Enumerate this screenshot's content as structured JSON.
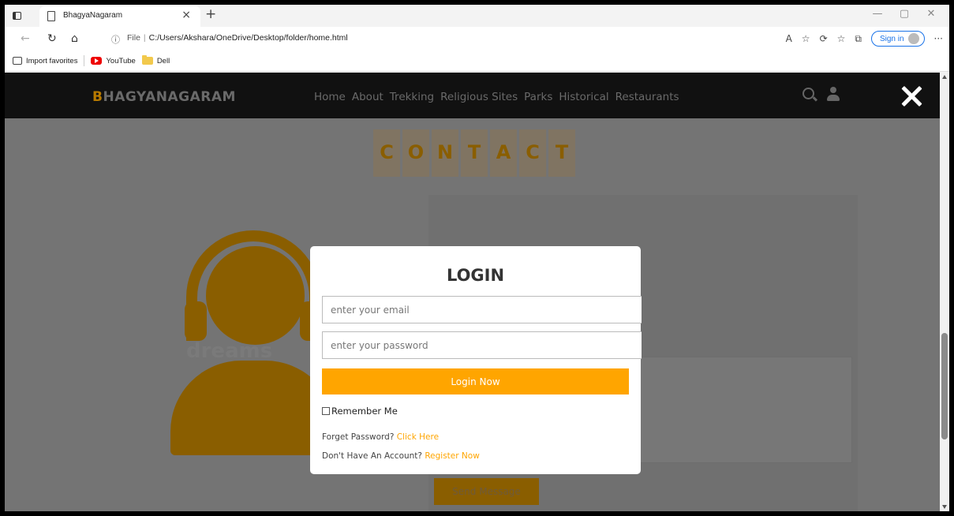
{
  "browser": {
    "tab_title": "BhagyaNagaram",
    "tab_close": "×",
    "new_tab": "+",
    "address": {
      "scheme_label": "File",
      "path": "C:/Users/Akshara/OneDrive/Desktop/folder/home.html"
    },
    "sign_in_label": "Sign in",
    "window_controls": [
      "—",
      "▢",
      "✕"
    ],
    "nav_icons": [
      "back-icon",
      "refresh-icon",
      "home-icon"
    ],
    "toolbar_icons": [
      "read-aloud-icon",
      "favorite-add-icon",
      "extensions-icon",
      "favorites-icon",
      "collections-icon",
      "more-icon"
    ]
  },
  "favorites": [
    {
      "label": "Import favorites",
      "icon": "import-icon"
    },
    {
      "label": "YouTube",
      "icon": "youtube-icon"
    },
    {
      "label": "Dell",
      "icon": "folder-icon"
    }
  ],
  "site": {
    "brand_first": "B",
    "brand_rest": "HAGYANAGARAM",
    "menu": [
      "Home",
      "About",
      "Trekking",
      "Religious Sites",
      "Parks",
      "Historical",
      "Restaurants"
    ],
    "contact_letters": [
      "C",
      "O",
      "N",
      "T",
      "A",
      "C",
      "T"
    ],
    "watermark": "dreams",
    "send_label": "Send Message"
  },
  "login": {
    "title": "LOGIN",
    "email_placeholder": "enter your email",
    "password_placeholder": "enter your password",
    "button_label": "Login Now",
    "remember_label": "Remember Me",
    "forget_text": "Forget Password?",
    "forget_link": "Click Here",
    "register_text": "Don't Have An Account?",
    "register_link": "Register Now"
  },
  "colors": {
    "accent": "#ffa500",
    "header_bg": "#111111",
    "overlay_bg": "#747474"
  }
}
